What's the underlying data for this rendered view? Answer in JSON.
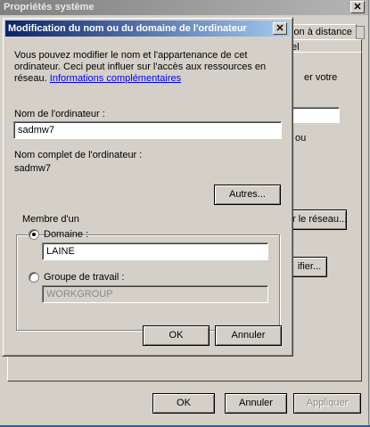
{
  "background_window": {
    "title": "Propriétés système",
    "close_glyph": "✕",
    "tabs": [
      "ion à distance",
      "el"
    ],
    "right_texts": [
      "er votre",
      "ou"
    ],
    "buttons": {
      "network": "r le réseau...",
      "modify": "ifier..."
    },
    "footer": {
      "ok": "OK",
      "cancel": "Annuler",
      "apply": "Appliquer"
    }
  },
  "dialog": {
    "title": "Modification du nom ou du domaine de l'ordinateur",
    "close_glyph": "✕",
    "intro_lines": [
      "Vous pouvez modifier le nom et l'appartenance de cet",
      "ordinateur. Ceci peut influer sur l'accès aux ressources en",
      "réseau."
    ],
    "info_link": "Informations complémentaires",
    "computer_name_label": "Nom de l'ordinateur :",
    "computer_name_value": "sadmw7",
    "full_name_label": "Nom complet de l'ordinateur :",
    "full_name_value": "sadmw7",
    "more_button": "Autres...",
    "member_of": {
      "legend": "Membre d'un",
      "domain_label": "Domaine :",
      "domain_value": "LAINE",
      "domain_selected": true,
      "workgroup_label": "Groupe de travail :",
      "workgroup_value": "WORKGROUP",
      "workgroup_selected": false
    },
    "ok_button": "OK",
    "cancel_button": "Annuler"
  }
}
